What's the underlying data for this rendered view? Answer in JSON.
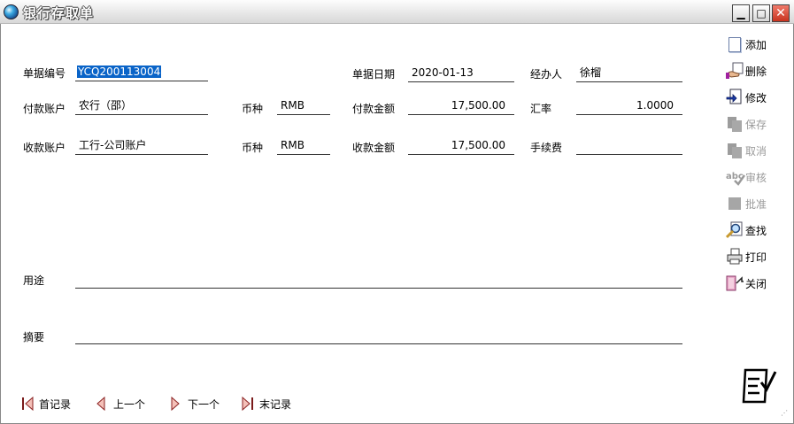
{
  "window": {
    "title": "银行存取单"
  },
  "form": {
    "doc_no_label": "单据编号",
    "doc_no": "YCQ200113004",
    "doc_date_label": "单据日期",
    "doc_date": "2020-01-13",
    "handler_label": "经办人",
    "handler": "徐榴",
    "pay_account_label": "付款账户",
    "pay_account": "农行（邵）",
    "pay_currency_label": "币种",
    "pay_currency": "RMB",
    "pay_amount_label": "付款金额",
    "pay_amount": "17,500.00",
    "rate_label": "汇率",
    "rate": "1.0000",
    "recv_account_label": "收款账户",
    "recv_account": "工行-公司账户",
    "recv_currency_label": "币种",
    "recv_currency": "RMB",
    "recv_amount_label": "收款金额",
    "recv_amount": "17,500.00",
    "fee_label": "手续费",
    "fee": "",
    "purpose_label": "用途",
    "purpose": "",
    "summary_label": "摘要",
    "summary": ""
  },
  "toolbar": {
    "add": "添加",
    "delete": "删除",
    "edit": "修改",
    "save": "保存",
    "cancel": "取消",
    "audit": "审核",
    "approve": "批准",
    "find": "查找",
    "print": "打印",
    "close": "关闭"
  },
  "nav": {
    "first": "首记录",
    "prev": "上一个",
    "next": "下一个",
    "last": "末记录"
  }
}
